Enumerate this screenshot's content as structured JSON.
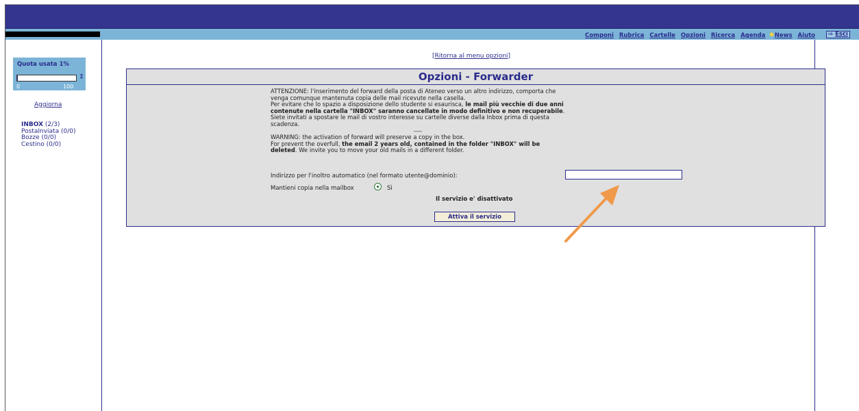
{
  "topnav": {
    "links": [
      "Componi",
      "Rubrica",
      "Cartelle",
      "Opzioni",
      "Ricerca",
      "Agenda"
    ],
    "news": "News",
    "aiuto": "Aiuto",
    "esci": "Esci"
  },
  "sidebar": {
    "quota_label": "Quota usata 1%",
    "quota_fraction": 0.01,
    "quota_min": "0",
    "quota_max": "100",
    "aggiorna": "Aggiorna",
    "folders": [
      {
        "name": "INBOX",
        "count": "(2/3)"
      },
      {
        "name": "PostaInviata",
        "count": "(0/0)"
      },
      {
        "name": "Bozze",
        "count": "(0/0)"
      },
      {
        "name": "Cestino",
        "count": "(0/0)"
      }
    ]
  },
  "main": {
    "back_link": "Ritorna al menu opzioni",
    "title": "Opzioni - Forwarder",
    "warning_it": {
      "p1": "ATTENZIONE: l'inserimento del forward della posta di Ateneo verso un altro indirizzo, comporta che venga comunque mantenuta copia delle mail ricevute nella casella.",
      "p2_start": "Per evitare che lo spazio a disposizione dello studente si esaurisca, ",
      "p2_bold": "le mail più vecchie di due anni contenute nella cartella \"INBOX\" saranno cancellate in modo definitivo e non recuperabile",
      "p2_end": ". Siete invitati a spostare le mail di vostro interesse su cartelle diverse dalla Inbox prima di questa scadenza."
    },
    "separator": "----",
    "warning_en": {
      "p1": "WARNING: the activation of forward will preserve a copy in the box.",
      "p2_start": "For prevent the overfull, ",
      "p2_bold1": "the email 2 years old, contained in the folder \"INBOX\" will be deleted",
      "p2_end": ". We invite you to move your old mails in a different folder."
    },
    "forward_label": "Indirizzo per l'inoltro automatico (nel formato utente@dominio):",
    "forward_value": "",
    "keep_copy_label": "Mantieni copia nella mailbox",
    "keep_copy_option": "Sì",
    "status": "Il servizio e' disattivato",
    "activate_button": "Attiva il servizio"
  },
  "colors": {
    "brand_dark": "#33358f",
    "nav_light": "#7cb4d8",
    "panel_bg": "#e0e0e0",
    "arrow": "#f0994a"
  }
}
